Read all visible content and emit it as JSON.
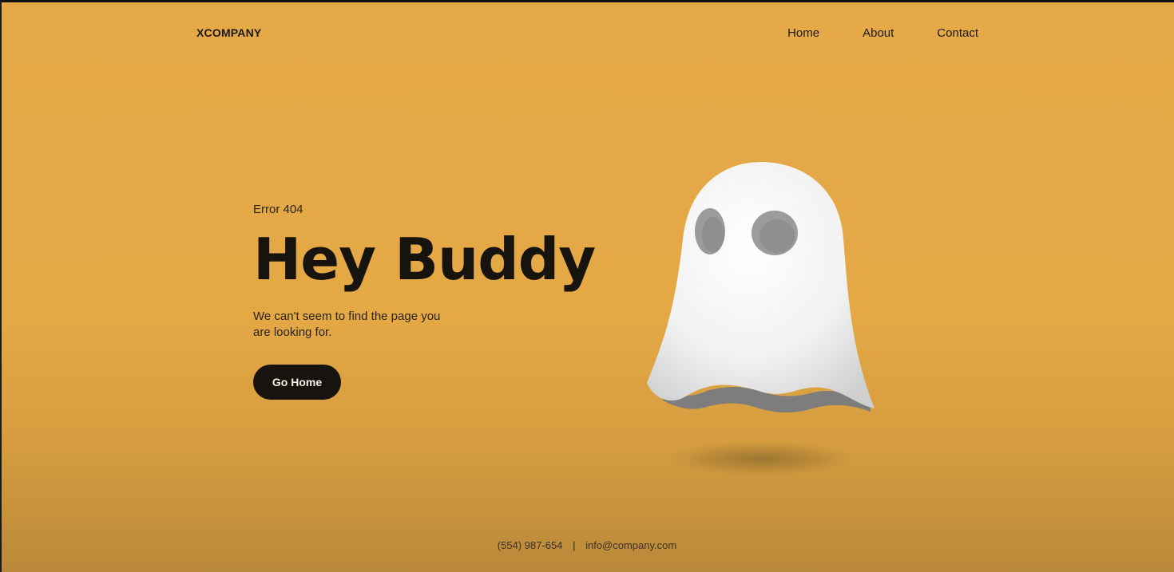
{
  "nav": {
    "brand": "XCOMPANY",
    "links": [
      "Home",
      "About",
      "Contact"
    ]
  },
  "hero": {
    "kicker": "Error 404",
    "headline": "Hey Buddy",
    "subtext": "We can't seem to find the page you are looking for.",
    "button_label": "Go Home"
  },
  "illustration": {
    "icon": "ghost-icon"
  },
  "footer": {
    "phone": "(554) 987-654",
    "separator": "|",
    "email": "info@company.com"
  },
  "colors": {
    "background": "#e6a947",
    "button": "#17140f",
    "text": "#1d1a16"
  }
}
